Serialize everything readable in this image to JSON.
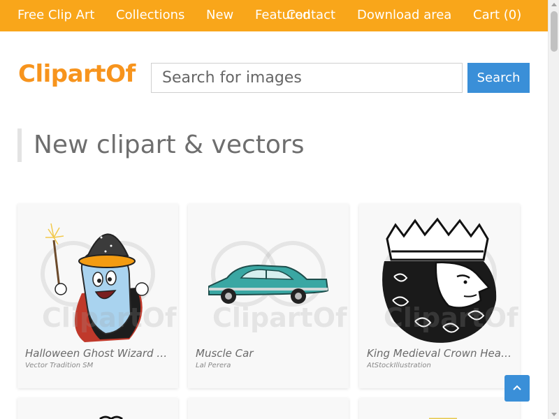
{
  "nav": {
    "items": [
      {
        "label": "Free Clip Art"
      },
      {
        "label": "Collections"
      },
      {
        "label": "New"
      },
      {
        "label": "Featured"
      },
      {
        "label": "Contact"
      },
      {
        "label": "Download area"
      },
      {
        "label": "Cart (0)"
      }
    ]
  },
  "header": {
    "logo": "ClipartOf",
    "search": {
      "placeholder": "Search for images",
      "value": ""
    },
    "search_button": "Search"
  },
  "main": {
    "section_title": "New clipart & vectors",
    "cards": [
      {
        "title": "Halloween Ghost Wizard Clip...",
        "author": "Vector Tradition SM",
        "watermark": "ClipartOf"
      },
      {
        "title": "Muscle Car",
        "author": "Lal Perera",
        "watermark": "ClipartOf"
      },
      {
        "title": "King Medieval Crown Head Fa...",
        "author": "AtStockIllustration",
        "watermark": "ClipartOf"
      }
    ]
  },
  "colors": {
    "nav_bg": "#f9a61a",
    "logo": "#f7941d",
    "button": "#3a8fd8"
  },
  "icons": {
    "back_to_top": "chevron-up-icon"
  }
}
